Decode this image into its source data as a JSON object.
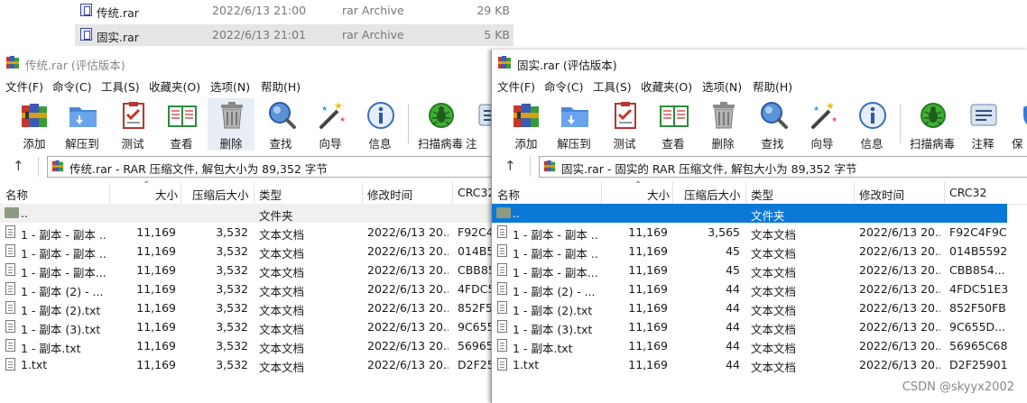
{
  "background_rows": [
    {
      "name": "传统.rar",
      "date": "2022/6/13 21:00",
      "type": "rar Archive",
      "size": "29 KB",
      "selected": false
    },
    {
      "name": "固实.rar",
      "date": "2022/6/13 21:01",
      "type": "rar Archive",
      "size": "5 KB",
      "selected": true
    }
  ],
  "left": {
    "title": "传统.rar (评估版本)",
    "menu": [
      "文件(F)",
      "命令(C)",
      "工具(S)",
      "收藏夹(O)",
      "选项(N)",
      "帮助(H)"
    ],
    "tools": [
      "添加",
      "解压到",
      "测试",
      "查看",
      "删除",
      "查找",
      "向导",
      "信息",
      "扫描病毒",
      "注"
    ],
    "address": "传统.rar - RAR 压缩文件, 解包大小为 89,352 字节",
    "columns": [
      "名称",
      "大小",
      "压缩后大小",
      "类型",
      "修改时间",
      "CRC32"
    ],
    "parent": {
      "name": "..",
      "type": "文件夹"
    },
    "rows": [
      {
        "name": "1 - 副本 - 副本 ...",
        "size": "11,169",
        "packed": "3,532",
        "type": "文本文档",
        "modified": "2022/6/13 20...",
        "crc": "F92C4"
      },
      {
        "name": "1 - 副本 - 副本 ...",
        "size": "11,169",
        "packed": "3,532",
        "type": "文本文档",
        "modified": "2022/6/13 20...",
        "crc": "014B5"
      },
      {
        "name": "1 - 副本 - 副本...",
        "size": "11,169",
        "packed": "3,532",
        "type": "文本文档",
        "modified": "2022/6/13 20...",
        "crc": "CBB85"
      },
      {
        "name": "1 - 副本 (2) - ...",
        "size": "11,169",
        "packed": "3,532",
        "type": "文本文档",
        "modified": "2022/6/13 20...",
        "crc": "4FDC5"
      },
      {
        "name": "1 - 副本 (2).txt",
        "size": "11,169",
        "packed": "3,532",
        "type": "文本文档",
        "modified": "2022/6/13 20...",
        "crc": "852F5"
      },
      {
        "name": "1 - 副本 (3).txt",
        "size": "11,169",
        "packed": "3,532",
        "type": "文本文档",
        "modified": "2022/6/13 20...",
        "crc": "9C655"
      },
      {
        "name": "1 - 副本.txt",
        "size": "11,169",
        "packed": "3,532",
        "type": "文本文档",
        "modified": "2022/6/13 20...",
        "crc": "56965"
      },
      {
        "name": "1.txt",
        "size": "11,169",
        "packed": "3,532",
        "type": "文本文档",
        "modified": "2022/6/13 20...",
        "crc": "D2F25"
      }
    ]
  },
  "right": {
    "title": "固实.rar (评估版本)",
    "menu": [
      "文件(F)",
      "命令(C)",
      "工具(S)",
      "收藏夹(O)",
      "选项(N)",
      "帮助(H)"
    ],
    "tools": [
      "添加",
      "解压到",
      "测试",
      "查看",
      "删除",
      "查找",
      "向导",
      "信息",
      "扫描病毒",
      "注释",
      "保"
    ],
    "address": "固实.rar - 固实的 RAR 压缩文件, 解包大小为 89,352 字节",
    "columns": [
      "名称",
      "大小",
      "压缩后大小",
      "类型",
      "修改时间",
      "CRC32"
    ],
    "parent": {
      "name": "..",
      "type": "文件夹"
    },
    "rows": [
      {
        "name": "1 - 副本 - 副本 ...",
        "size": "11,169",
        "packed": "3,565",
        "type": "文本文档",
        "modified": "2022/6/13 20...",
        "crc": "F92C4F9C"
      },
      {
        "name": "1 - 副本 - 副本 ...",
        "size": "11,169",
        "packed": "45",
        "type": "文本文档",
        "modified": "2022/6/13 20...",
        "crc": "014B5592"
      },
      {
        "name": "1 - 副本 - 副本...",
        "size": "11,169",
        "packed": "45",
        "type": "文本文档",
        "modified": "2022/6/13 20...",
        "crc": "CBB854..."
      },
      {
        "name": "1 - 副本 (2) - ...",
        "size": "11,169",
        "packed": "44",
        "type": "文本文档",
        "modified": "2022/6/13 20...",
        "crc": "4FDC51E3"
      },
      {
        "name": "1 - 副本 (2).txt",
        "size": "11,169",
        "packed": "44",
        "type": "文本文档",
        "modified": "2022/6/13 20...",
        "crc": "852F50FB"
      },
      {
        "name": "1 - 副本 (3).txt",
        "size": "11,169",
        "packed": "44",
        "type": "文本文档",
        "modified": "2022/6/13 20...",
        "crc": "9C655D..."
      },
      {
        "name": "1 - 副本.txt",
        "size": "11,169",
        "packed": "44",
        "type": "文本文档",
        "modified": "2022/6/13 20...",
        "crc": "56965C68"
      },
      {
        "name": "1.txt",
        "size": "11,169",
        "packed": "44",
        "type": "文本文档",
        "modified": "2022/6/13 20...",
        "crc": "D2F25901"
      }
    ]
  },
  "watermark": "CSDN @skyyx2002"
}
